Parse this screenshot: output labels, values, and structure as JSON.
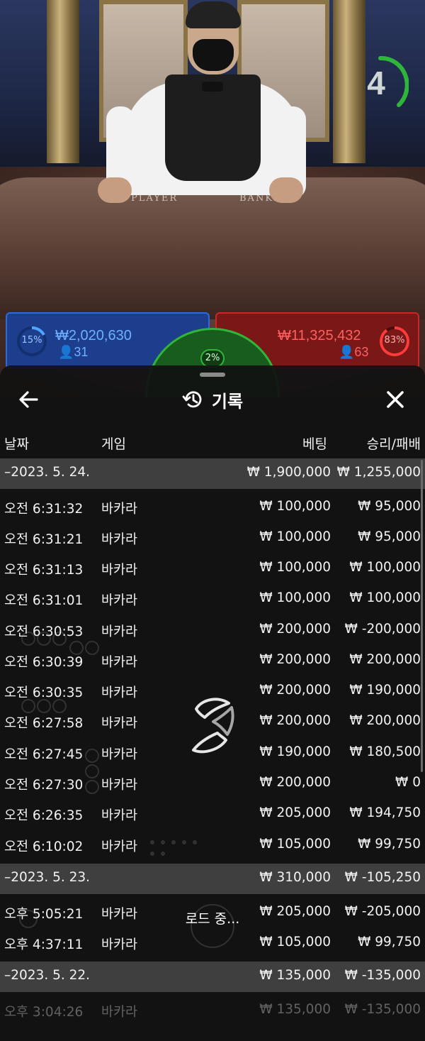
{
  "stage": {
    "timer_value": "4",
    "table_labels": {
      "player": "PLAYER",
      "banker": "BANKER"
    },
    "player": {
      "percent": "15%",
      "amount": "₩2,020,630",
      "count": "31",
      "color": "#2f6ad6"
    },
    "banker": {
      "percent": "83%",
      "amount": "₩11,325,432",
      "count": "63",
      "color": "#c42828"
    },
    "tie": {
      "percent": "2%",
      "color": "#2fb53a"
    }
  },
  "sheet": {
    "title": "기록",
    "history_icon": "history-icon",
    "back_icon": "arrow-left-icon",
    "close_icon": "close-icon",
    "columns": {
      "date": "날짜",
      "game": "게임",
      "bet": "베팅",
      "win_loss": "승리/패배"
    },
    "loading_text": "로드 중...",
    "groups": [
      {
        "date": "–2023. 5. 24.",
        "bet": "₩ 1,900,000",
        "win": "₩ 1,255,000",
        "rows": [
          {
            "time": "오전 6:31:32",
            "game": "바카라",
            "bet": "₩ 100,000",
            "win": "₩ 95,000"
          },
          {
            "time": "오전 6:31:21",
            "game": "바카라",
            "bet": "₩ 100,000",
            "win": "₩ 95,000"
          },
          {
            "time": "오전 6:31:13",
            "game": "바카라",
            "bet": "₩ 100,000",
            "win": "₩ 100,000"
          },
          {
            "time": "오전 6:31:01",
            "game": "바카라",
            "bet": "₩ 100,000",
            "win": "₩ 100,000"
          },
          {
            "time": "오전 6:30:53",
            "game": "바카라",
            "bet": "₩ 200,000",
            "win": "₩ -200,000"
          },
          {
            "time": "오전 6:30:39",
            "game": "바카라",
            "bet": "₩ 200,000",
            "win": "₩ 200,000"
          },
          {
            "time": "오전 6:30:35",
            "game": "바카라",
            "bet": "₩ 200,000",
            "win": "₩ 190,000"
          },
          {
            "time": "오전 6:27:58",
            "game": "바카라",
            "bet": "₩ 200,000",
            "win": "₩ 200,000"
          },
          {
            "time": "오전 6:27:45",
            "game": "바카라",
            "bet": "₩ 190,000",
            "win": "₩ 180,500"
          },
          {
            "time": "오전 6:27:30",
            "game": "바카라",
            "bet": "₩ 200,000",
            "win": "₩ 0"
          },
          {
            "time": "오전 6:26:35",
            "game": "바카라",
            "bet": "₩ 205,000",
            "win": "₩ 194,750"
          },
          {
            "time": "오전 6:10:02",
            "game": "바카라",
            "bet": "₩ 105,000",
            "win": "₩ 99,750"
          }
        ]
      },
      {
        "date": "–2023. 5. 23.",
        "bet": "₩ 310,000",
        "win": "₩ -105,250",
        "rows": [
          {
            "time": "오후 5:05:21",
            "game": "바카라",
            "bet": "₩ 205,000",
            "win": "₩ -205,000"
          },
          {
            "time": "오후 4:37:11",
            "game": "바카라",
            "bet": "₩ 105,000",
            "win": "₩ 99,750"
          }
        ]
      },
      {
        "date": "–2023. 5. 22.",
        "bet": "₩ 135,000",
        "win": "₩ -135,000",
        "rows": [
          {
            "time": "오후 3:04:26",
            "game": "바카라",
            "bet": "₩ 135,000",
            "win": "₩ -135,000"
          }
        ]
      }
    ]
  }
}
